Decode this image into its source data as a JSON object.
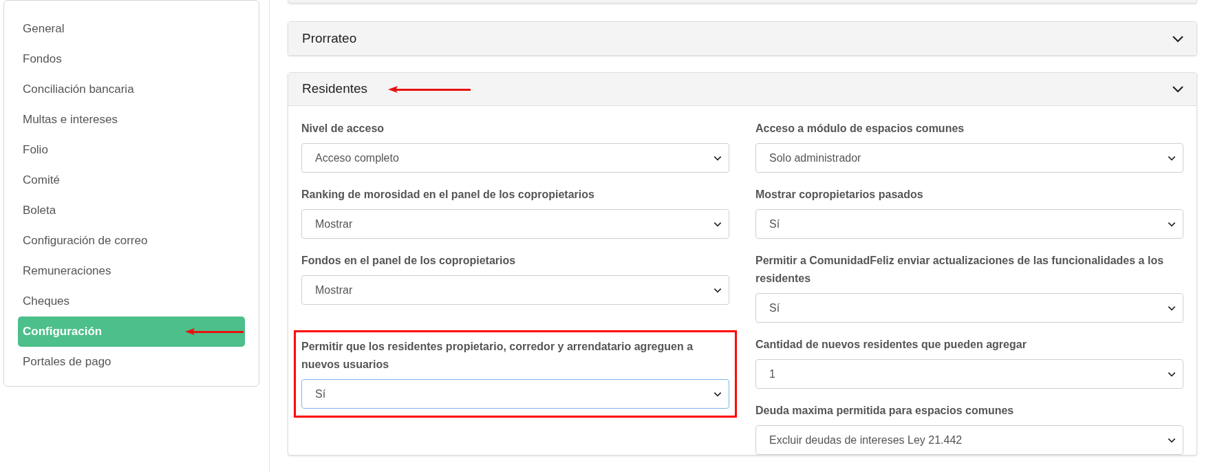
{
  "sidebar": {
    "items": [
      {
        "label": "General",
        "selected": false,
        "arrow": false
      },
      {
        "label": "Fondos",
        "selected": false,
        "arrow": false
      },
      {
        "label": "Conciliación bancaria",
        "selected": false,
        "arrow": false
      },
      {
        "label": "Multas e intereses",
        "selected": false,
        "arrow": false
      },
      {
        "label": "Folio",
        "selected": false,
        "arrow": false
      },
      {
        "label": "Comité",
        "selected": false,
        "arrow": false
      },
      {
        "label": "Boleta",
        "selected": false,
        "arrow": false
      },
      {
        "label": "Configuración de correo",
        "selected": false,
        "arrow": false
      },
      {
        "label": "Remuneraciones",
        "selected": false,
        "arrow": false
      },
      {
        "label": "Cheques",
        "selected": false,
        "arrow": false
      },
      {
        "label": "Configuración",
        "selected": true,
        "arrow": true
      },
      {
        "label": "Portales de pago",
        "selected": false,
        "arrow": false
      }
    ]
  },
  "panels": [
    {
      "title": "Prorrateo",
      "expanded": false,
      "arrow": false
    },
    {
      "title": "Residentes",
      "expanded": true,
      "arrow": true,
      "columns": [
        [
          {
            "label": "Nivel de acceso",
            "value": "Acceso completo",
            "focused": false,
            "highlighted": false
          },
          {
            "label": "Ranking de morosidad en el panel de los copropietarios",
            "value": "Mostrar",
            "focused": false,
            "highlighted": false
          },
          {
            "label": "Fondos en el panel de los copropietarios",
            "value": "Mostrar",
            "focused": false,
            "highlighted": false
          },
          {
            "label": "Permitir que los residentes propietario, corredor y arrendatario agreguen a nuevos usuarios",
            "value": "Sí",
            "focused": true,
            "highlighted": true
          }
        ],
        [
          {
            "label": "Acceso a módulo de espacios comunes",
            "value": "Solo administrador",
            "focused": false,
            "highlighted": false
          },
          {
            "label": "Mostrar copropietarios pasados",
            "value": "Sí",
            "focused": false,
            "highlighted": false
          },
          {
            "label": "Permitir a ComunidadFeliz enviar actualizaciones de las funcionalidades a los residentes",
            "value": "Sí",
            "focused": false,
            "highlighted": false
          },
          {
            "label": "Cantidad de nuevos residentes que pueden agregar",
            "value": "1",
            "focused": false,
            "highlighted": false
          },
          {
            "label": "Deuda maxima permitida para espacios comunes",
            "value": "Excluir deudas de intereses Ley 21.442",
            "focused": false,
            "highlighted": false
          }
        ]
      ]
    }
  ]
}
